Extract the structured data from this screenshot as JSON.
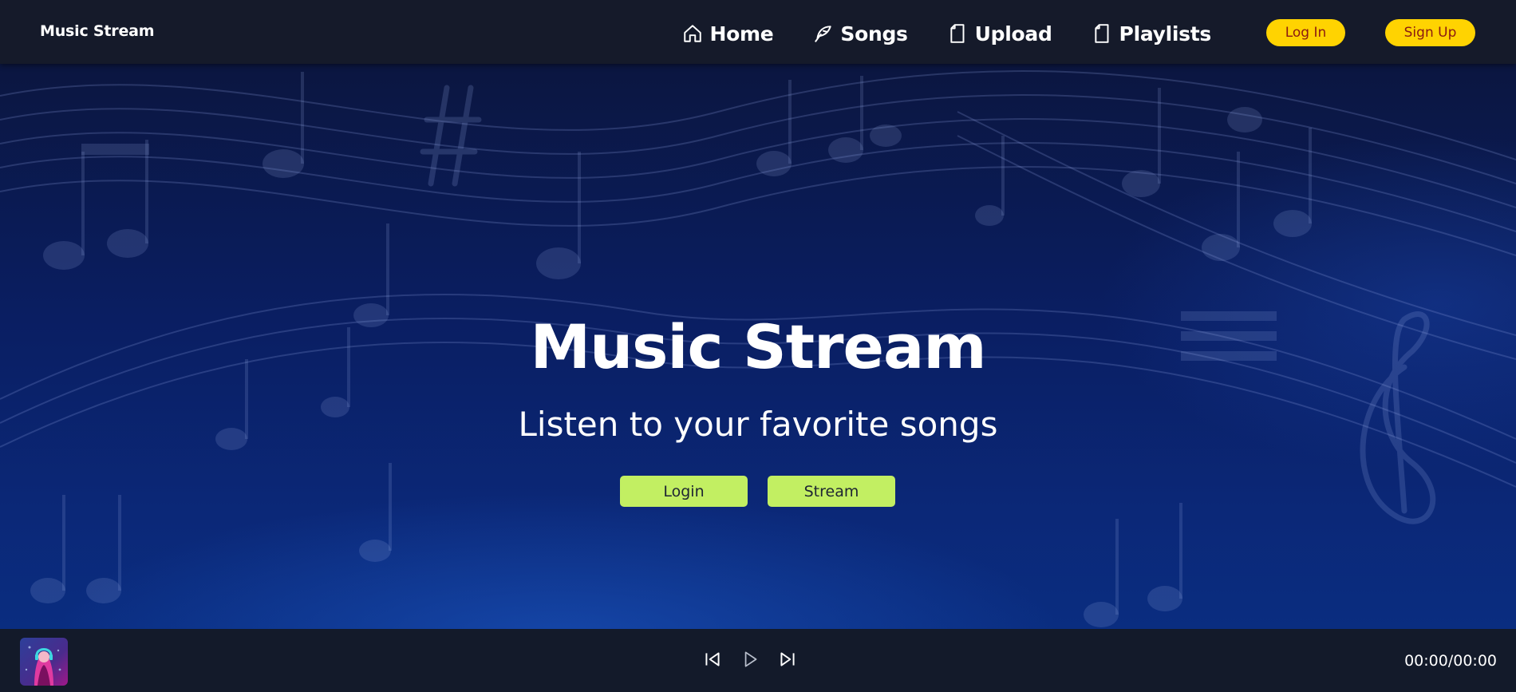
{
  "header": {
    "brand": "Music Stream",
    "nav": [
      {
        "label": "Home",
        "icon": "home-icon"
      },
      {
        "label": "Songs",
        "icon": "feather-icon"
      },
      {
        "label": "Upload",
        "icon": "file-icon"
      },
      {
        "label": "Playlists",
        "icon": "file-icon"
      }
    ],
    "login_label": "Log In",
    "signup_label": "Sign Up"
  },
  "hero": {
    "title": "Music Stream",
    "subtitle": "Listen to your favorite songs",
    "login_label": "Login",
    "stream_label": "Stream"
  },
  "player": {
    "time": "00:00/00:00",
    "icons": [
      "skip-back-icon",
      "play-icon",
      "skip-forward-icon"
    ]
  },
  "colors": {
    "nav_bg": "#151a2a",
    "accent_yellow": "#ffd301",
    "accent_lime": "#c2ef62",
    "hero_blue": "#0a1e62"
  }
}
